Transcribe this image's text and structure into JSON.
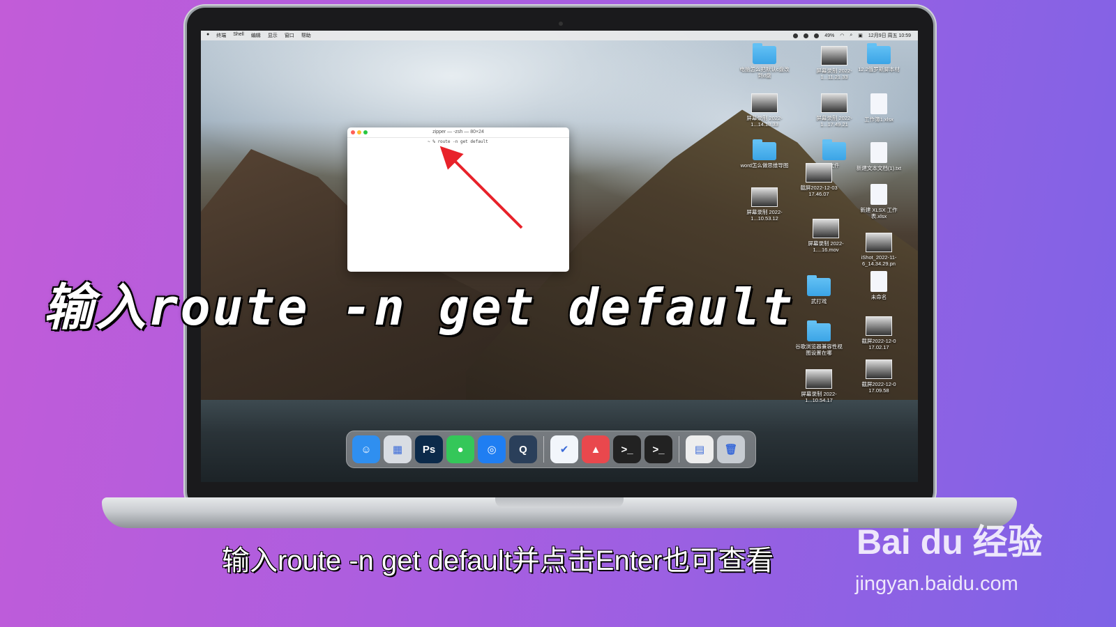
{
  "menubar": {
    "apple": "",
    "items": [
      "终端",
      "Shell",
      "编辑",
      "显示",
      "窗口",
      "帮助"
    ],
    "battery": "49%",
    "datetime": "12月9日 周五 10:59"
  },
  "terminal": {
    "title": "zipper — -zsh — 80×24",
    "command": "~ % route -n get default"
  },
  "desktop_icons": [
    {
      "label": "电脑怎么把默认c盘改到d盘",
      "kind": "folder"
    },
    {
      "label": "屏幕录制 2022-1...11.21.33",
      "kind": "thumb"
    },
    {
      "label": "12.2俄罗斯脚本材",
      "kind": "folder"
    },
    {
      "label": "屏幕录制 2022-1...14.18.33",
      "kind": "thumb"
    },
    {
      "label": "屏幕录制 2022-1...17.49.21",
      "kind": "thumb"
    },
    {
      "label": "工作簿1.xlsx",
      "kind": "doc"
    },
    {
      "label": "word怎么做思维导图",
      "kind": "folder"
    },
    {
      "label": "文件",
      "kind": "folder"
    },
    {
      "label": "新建文本文档(1).txt",
      "kind": "doc"
    },
    {
      "label": "截屏2022-12-03 17.46.07",
      "kind": "thumb"
    },
    {
      "label": "屏幕录制 2022-1...10.53.12",
      "kind": "thumb"
    },
    {
      "label": "新建 XLSX 工作表.xlsx",
      "kind": "doc"
    },
    {
      "label": "屏幕录制 2022-1....16.mov",
      "kind": "thumb"
    },
    {
      "label": "iShot_2022-11-6_14.34.29.pn",
      "kind": "thumb"
    },
    {
      "label": "武打戏",
      "kind": "folder"
    },
    {
      "label": "未命名",
      "kind": "doc"
    },
    {
      "label": "截屏2022-12-0 17.02.17",
      "kind": "thumb"
    },
    {
      "label": "谷歌浏览器兼容性视图设置在哪",
      "kind": "folder"
    },
    {
      "label": "截屏2022-12-0 17.09.58",
      "kind": "thumb"
    },
    {
      "label": "屏幕录制 2022-1...10.54.17",
      "kind": "thumb"
    }
  ],
  "dock": [
    {
      "name": "finder",
      "glyph": "☺",
      "color": "#2f8ff0"
    },
    {
      "name": "launchpad",
      "glyph": "▦",
      "color": "#d9dde3"
    },
    {
      "name": "photoshop",
      "glyph": "Ps",
      "color": "#0b2a4a"
    },
    {
      "name": "messages",
      "glyph": "●",
      "color": "#34c759"
    },
    {
      "name": "safari",
      "glyph": "◎",
      "color": "#1f7ef2"
    },
    {
      "name": "quicktime",
      "glyph": "Q",
      "color": "#2a3f5a"
    },
    {
      "name": "app-blue",
      "glyph": "✔",
      "color": "#f2f6fb"
    },
    {
      "name": "app-red",
      "glyph": "▲",
      "color": "#e9484d"
    },
    {
      "name": "terminal-1",
      "glyph": ">_",
      "color": "#222"
    },
    {
      "name": "terminal-2",
      "glyph": ">_",
      "color": "#222"
    },
    {
      "name": "preview",
      "glyph": "▤",
      "color": "#eee"
    },
    {
      "name": "trash",
      "glyph": "🗑",
      "color": "#c7ccd2"
    }
  ],
  "overlay": {
    "big_caption": "输入route -n get default",
    "subtitle": "输入route -n get default并点击Enter也可查看"
  },
  "watermark": {
    "logo": "Bai du 经验",
    "url": "jingyan.baidu.com"
  }
}
